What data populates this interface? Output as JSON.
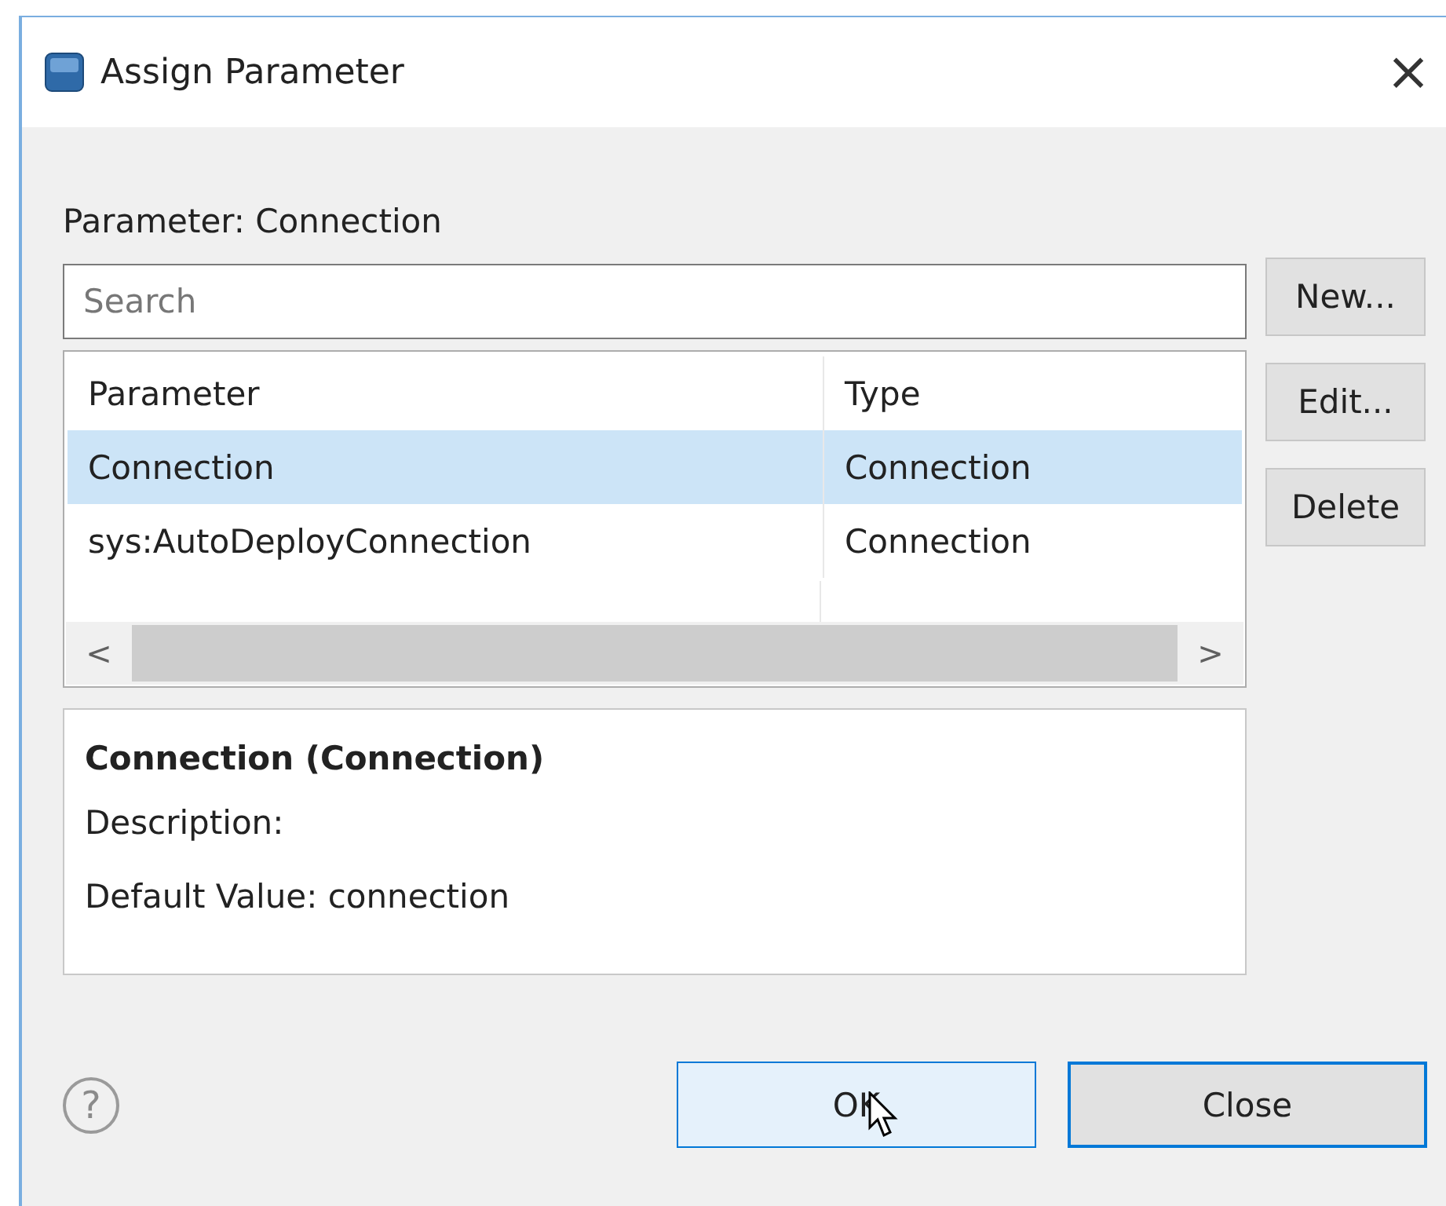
{
  "window": {
    "title": "Assign Parameter",
    "close": "×"
  },
  "parameter_label": "Parameter: Connection",
  "search": {
    "placeholder": "Search"
  },
  "side_buttons": [
    "New...",
    "Edit...",
    "Delete"
  ],
  "table": {
    "columns": [
      "Parameter",
      "Type"
    ],
    "rows": [
      {
        "cells": [
          "Connection",
          "Connection"
        ],
        "selected": true
      },
      {
        "cells": [
          "sys:AutoDeployConnection",
          "Connection"
        ],
        "selected": false
      }
    ],
    "scroll_left": "<",
    "scroll_right": ">"
  },
  "details": {
    "title": "Connection (Connection)",
    "lines": [
      "Description:",
      "Default Value: connection"
    ]
  },
  "footer": {
    "help": "?",
    "buttons": [
      {
        "label": "OK",
        "kind": "primary"
      },
      {
        "label": "Close",
        "kind": "default"
      }
    ]
  }
}
